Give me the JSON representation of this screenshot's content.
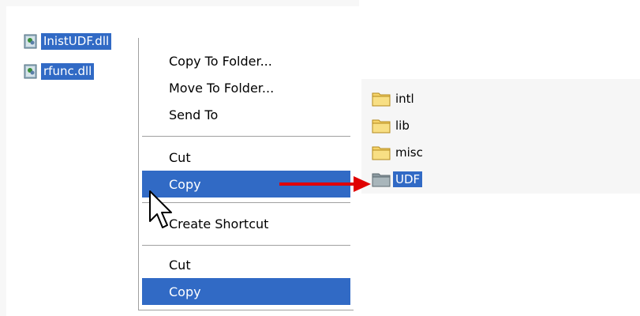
{
  "files": [
    {
      "name": "InistUDF.dll",
      "selected": true,
      "icon": "dll-file-icon"
    },
    {
      "name": "rfunc.dll",
      "selected": true,
      "icon": "dll-file-icon"
    }
  ],
  "context_menu": {
    "items": [
      {
        "label": "Copy To Folder..."
      },
      {
        "label": "Move To Folder..."
      },
      {
        "label": "Send To"
      },
      {
        "label": "Cut"
      },
      {
        "label": "Copy",
        "highlighted": true
      },
      {
        "label": "Create Shortcut"
      },
      {
        "label": "Cut"
      },
      {
        "label": "Copy",
        "highlighted": true
      }
    ]
  },
  "folders": [
    {
      "name": "intl",
      "icon": "folder-icon"
    },
    {
      "name": "lib",
      "icon": "folder-icon"
    },
    {
      "name": "misc",
      "icon": "folder-icon"
    },
    {
      "name": "UDF",
      "icon": "folder-gray-icon",
      "selected": true
    }
  ],
  "colors": {
    "selection": "#316ac5",
    "arrow": "#e00000",
    "folder_yellow": "#f5d36a",
    "folder_gray": "#9aa7ad"
  }
}
